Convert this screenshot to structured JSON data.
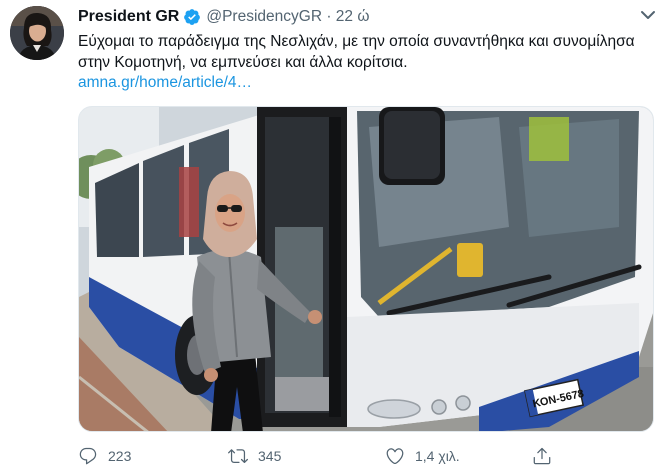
{
  "tweet": {
    "author_name": "President GR",
    "handle_time": "@PresidencyGR · 22 ώ",
    "text": "Εύχομαι το παράδειγμα της Νεσλιχάν, με την οποία συναντήθηκα και συνομίλησα στην Κομοτηνή, να εμπνεύσει και άλλα κορίτσια.",
    "link": "amna.gr/home/article/4…",
    "bus_plate": "ΚΟΝ-5678",
    "actions": {
      "replies": "223",
      "retweets": "345",
      "likes": "1,4 χιλ."
    }
  },
  "icons": {
    "verified": "verified-badge-icon",
    "caret": "chevron-down-icon",
    "reply": "reply-icon",
    "retweet": "retweet-icon",
    "like": "heart-icon",
    "share": "share-icon"
  },
  "colors": {
    "accent": "#1da1f2",
    "link": "#1b95e0",
    "muted": "#536471"
  }
}
